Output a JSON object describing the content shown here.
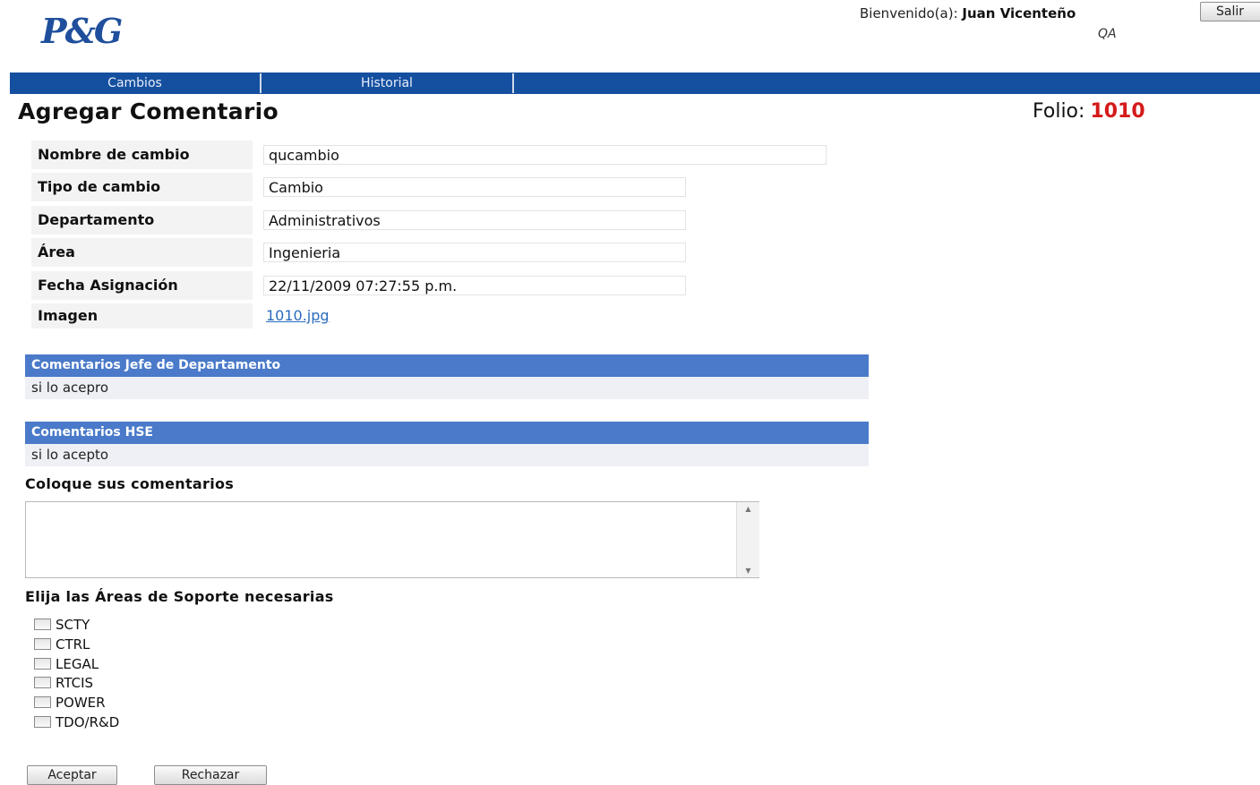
{
  "header": {
    "logo": "P&G",
    "welcome_label": "Bienvenido(a):",
    "user_name": "Juan Vicenteño",
    "role": "QA",
    "logout_label": "Salir"
  },
  "nav": {
    "tabs": [
      {
        "label": "Cambios"
      },
      {
        "label": "Historial"
      }
    ]
  },
  "page": {
    "title": "Agregar Comentario",
    "folio_label": "Folio:",
    "folio_number": "1010"
  },
  "fields": [
    {
      "label": "Nombre de cambio",
      "value": "qucambio"
    },
    {
      "label": "Tipo de cambio",
      "value": "Cambio"
    },
    {
      "label": "Departamento",
      "value": "Administrativos"
    },
    {
      "label": "Área",
      "value": "Ingenieria"
    },
    {
      "label": "Fecha Asignación",
      "value": "22/11/2009 07:27:55 p.m."
    },
    {
      "label": "Imagen",
      "value": "1010.jpg"
    }
  ],
  "comments": [
    {
      "header": "Comentarios Jefe de Departamento",
      "text": "si lo acepro"
    },
    {
      "header": "Comentarios HSE",
      "text": "si lo acepto"
    }
  ],
  "form": {
    "comments_label": "Coloque sus comentarios",
    "comments_value": "",
    "support_label": "Elija las Áreas de Soporte necesarias",
    "support_areas": [
      {
        "label": "SCTY",
        "checked": false
      },
      {
        "label": "CTRL",
        "checked": false
      },
      {
        "label": "LEGAL",
        "checked": false
      },
      {
        "label": "RTCIS",
        "checked": false
      },
      {
        "label": "POWER",
        "checked": false
      },
      {
        "label": "TDO/R&D",
        "checked": false
      }
    ],
    "accept_label": "Aceptar",
    "reject_label": "Rechazar"
  },
  "colors": {
    "nav_bar": "#1550a0",
    "panel_header": "#4a7ac9",
    "folio_number": "#d51a1a",
    "logo": "#1f4f9c",
    "link": "#2a6bbd"
  }
}
